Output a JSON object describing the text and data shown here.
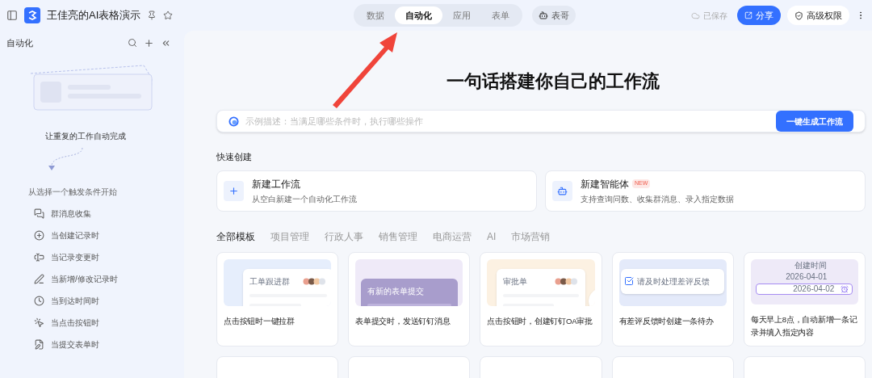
{
  "header": {
    "title": "王佳亮的AI表格演示",
    "tabs": [
      {
        "label": "数据",
        "selected": false
      },
      {
        "label": "自动化",
        "selected": true
      },
      {
        "label": "应用",
        "selected": false
      },
      {
        "label": "表单",
        "selected": false
      }
    ],
    "assistant": "表哥",
    "save_status": "已保存",
    "share": "分享",
    "permissions": "高级权限"
  },
  "sidebar": {
    "title": "自动化",
    "tagline": "让重复的工作自动完成",
    "hint": "从选择一个触发条件开始",
    "triggers": [
      {
        "kind": "group-message",
        "label": "群消息收集"
      },
      {
        "kind": "create",
        "label": "当创建记录时"
      },
      {
        "kind": "change",
        "label": "当记录变更时"
      },
      {
        "kind": "edit",
        "label": "当新增/修改记录时"
      },
      {
        "kind": "time",
        "label": "当到达时间时"
      },
      {
        "kind": "click",
        "label": "当点击按钮时"
      },
      {
        "kind": "form",
        "label": "当提交表单时"
      }
    ]
  },
  "main": {
    "heading": "一句话搭建你自己的工作流",
    "prompt": {
      "placeholder": "示例描述：当满足哪些条件时，执行哪些操作",
      "button": "一键生成工作流"
    },
    "quick_create": {
      "title": "快速创建",
      "items": [
        {
          "kind": "workflow",
          "title": "新建工作流",
          "description": "从空白新建一个自动化工作流"
        },
        {
          "kind": "agent",
          "title": "新建智能体",
          "badge": "NEW",
          "description": "支持查询问数、收集群消息、录入指定数据"
        }
      ]
    },
    "template_tabs": [
      {
        "label": "全部模板",
        "selected": true
      },
      {
        "label": "项目管理",
        "selected": false
      },
      {
        "label": "行政人事",
        "selected": false
      },
      {
        "label": "销售管理",
        "selected": false
      },
      {
        "label": "电商运营",
        "selected": false
      },
      {
        "label": "AI",
        "selected": false
      },
      {
        "label": "市场营销",
        "selected": false
      }
    ],
    "templates": [
      {
        "kind": "group",
        "preview": [
          "工单跟进群"
        ],
        "title": "点击按钮时一键拉群"
      },
      {
        "kind": "form",
        "preview": [
          "有新的表单提交"
        ],
        "title": "表单提交时，发送钉钉消息"
      },
      {
        "kind": "approval",
        "preview": [
          "审批单"
        ],
        "title": "点击按钮时，创建钉钉OA审批"
      },
      {
        "kind": "todo",
        "preview": [
          "请及时处理差评反馈"
        ],
        "title": "有差评反馈时创建一条待办"
      },
      {
        "kind": "schedule",
        "preview": [
          "创建时间",
          "2026-04-01",
          "2026-04-02"
        ],
        "title": "每天早上8点，自动新增一条记录并填入指定内容"
      }
    ]
  }
}
